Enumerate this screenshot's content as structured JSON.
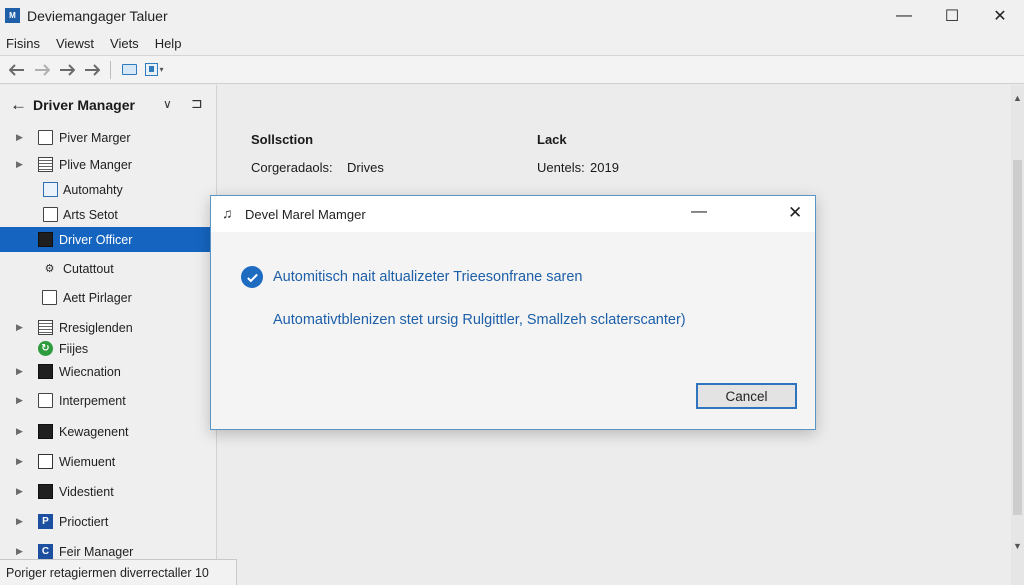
{
  "window": {
    "app_icon_text": "M",
    "title": "Deviemangager Taluer",
    "minimize": "—",
    "maximize": "☐",
    "close": "✕"
  },
  "menu": [
    "Fisins",
    "Viewst",
    "Viets",
    "Help"
  ],
  "toolbar": {
    "back_icon": "arrow-left-icon",
    "forward_icon": "arrow-right-icon",
    "dropdown_glyph": "▾"
  },
  "sidebar": {
    "back_glyph": "←",
    "title": "Driver Manager",
    "chevron_glyph": "∨",
    "pin_glyph": "⊐",
    "items": [
      {
        "label": "Piver Marger",
        "expandable": true,
        "icon": "document-icon",
        "selected": false
      },
      {
        "label": "Plive Manger",
        "expandable": true,
        "icon": "list-icon",
        "selected": false
      },
      {
        "label": "Automahty",
        "expandable": false,
        "icon": "window-icon",
        "selected": false
      },
      {
        "label": "Arts Setot",
        "expandable": false,
        "icon": "document-icon",
        "selected": false
      },
      {
        "label": "Driver Officer",
        "expandable": false,
        "icon": "chip-icon",
        "selected": true
      },
      {
        "label": "Cutattout",
        "expandable": false,
        "icon": "gear-icon",
        "selected": false
      },
      {
        "label": "Aett Pirlager",
        "expandable": false,
        "icon": "document-icon",
        "selected": false
      },
      {
        "label": "Rresiglenden",
        "expandable": true,
        "icon": "list-icon",
        "selected": false
      },
      {
        "label": "Fiijes",
        "expandable": false,
        "icon": "green-circle-icon",
        "selected": false
      },
      {
        "label": "Wiecnation",
        "expandable": true,
        "icon": "chip-icon",
        "selected": false
      },
      {
        "label": "Interpement",
        "expandable": true,
        "icon": "image-icon",
        "selected": false
      },
      {
        "label": "Kewagenent",
        "expandable": true,
        "icon": "chip-icon",
        "selected": false
      },
      {
        "label": "Wiemuent",
        "expandable": true,
        "icon": "monitor-icon",
        "selected": false
      },
      {
        "label": "Videstient",
        "expandable": true,
        "icon": "chip-icon",
        "selected": false
      },
      {
        "label": "Prioctiert",
        "expandable": true,
        "icon": "blue-p-icon",
        "selected": false
      },
      {
        "label": "Feir Manager",
        "expandable": true,
        "icon": "blue-c-icon",
        "selected": false
      }
    ],
    "expand_glyph": "▶",
    "green_glyph": "↻",
    "p_glyph": "P",
    "c_glyph": "C",
    "gear_glyph": "⚙"
  },
  "main": {
    "col1_heading": "Sollsction",
    "col2_heading": "Lack",
    "row1_label": "Corgeradaols:",
    "row1_value": "Drives",
    "row2_label": "Uentels:",
    "row2_value": "2019"
  },
  "scrollbar": {
    "up_glyph": "▲",
    "down_glyph": "▼"
  },
  "dialog": {
    "icon_glyph": "♫",
    "title": "Devel Marel Mamger",
    "minimize": "—",
    "close": "✕",
    "line1": "Automitisch nait altualizeter Trieesonfrane saren",
    "line2": "Automativtblenizen stet ursig Rulgittler, Smallzeh sclaterscanter)",
    "cancel_label": "Cancel"
  },
  "statusbar": {
    "text": "Poriger retagiermen diverrectaller 10"
  },
  "colors": {
    "accent": "#1565c0",
    "dialog_text": "#1d5fa8",
    "dialog_border": "#5a95c8"
  }
}
